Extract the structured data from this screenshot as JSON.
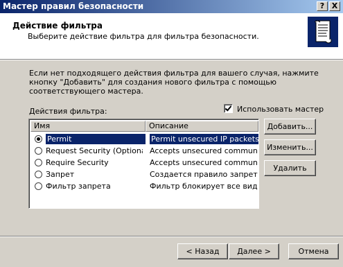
{
  "window": {
    "title": "Мастер правил безопасности",
    "help_glyph": "?",
    "close_glyph": "X"
  },
  "header": {
    "title": "Действие фильтра",
    "subtitle": "Выберите действие фильтра для фильтра  безопасности.",
    "icon": "scroll-document-icon"
  },
  "intro_text": "Если нет подходящего действия фильтра для вашего случая, нажмите кнопку \"Добавить\" для создания нового фильтра с помощью соответствующего мастера.",
  "filter_actions_label": "Действия фильтра:",
  "use_wizard": {
    "label": "Использовать мастер",
    "checked": true
  },
  "list": {
    "columns": [
      "Имя",
      "Описание"
    ],
    "rows": [
      {
        "name": "Permit",
        "description": "Permit unsecured IP packets t...",
        "selected": true
      },
      {
        "name": "Request Security (Optional)",
        "description": "Accepts unsecured communi...",
        "selected": false
      },
      {
        "name": "Require Security",
        "description": "Accepts unsecured communi...",
        "selected": false
      },
      {
        "name": "Запрет",
        "description": "Создается правило запрет...",
        "selected": false
      },
      {
        "name": "Фильтр запрета",
        "description": "Фильтр блокирует все вид...",
        "selected": false
      }
    ]
  },
  "side_buttons": {
    "add": "Добавить...",
    "edit": "Изменить...",
    "remove": "Удалить"
  },
  "footer_buttons": {
    "back": "< Назад",
    "next": "Далее >",
    "cancel": "Отмена"
  },
  "colors": {
    "title_bar": "#0a246a",
    "selection": "#0a246a",
    "face": "#d4d0c8"
  }
}
